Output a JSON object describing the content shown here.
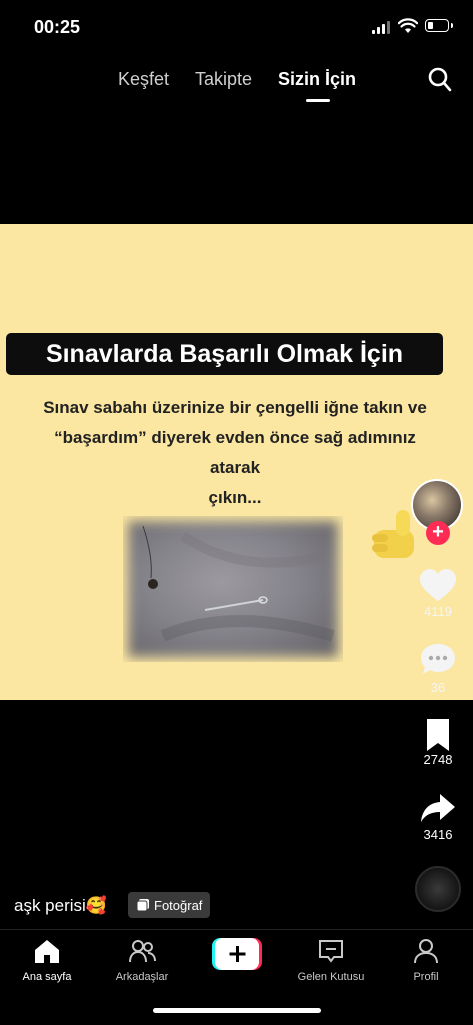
{
  "status_bar": {
    "time": "00:25",
    "battery_level": 0.3
  },
  "top_nav": {
    "tabs": [
      {
        "label": "Keşfet",
        "active": false
      },
      {
        "label": "Takipte",
        "active": false
      },
      {
        "label": "Sizin İçin",
        "active": true
      }
    ],
    "search_icon": "search-icon"
  },
  "post": {
    "title": "Sınavlarda Başarılı Olmak İçin",
    "text_lines": [
      "Sınav sabahı üzerinize bir çengelli iğne takın ve",
      "“başardım” diyerek evden önce sağ adımınız atarak",
      "çıkın..."
    ],
    "likes": "4119",
    "comments": "36",
    "bookmarks": "2748",
    "shares": "3416",
    "author": "aşk perisi🥰",
    "type_label": "Fotoğraf"
  },
  "colors": {
    "accent": "#fe2c55",
    "photo_bg": "#fbe7a2"
  },
  "bottom_nav": {
    "items": [
      {
        "label": "Ana sayfa",
        "icon": "home-icon",
        "active": true
      },
      {
        "label": "Arkadaşlar",
        "icon": "friends-icon",
        "active": false
      },
      {
        "label": "",
        "icon": "plus-icon",
        "active": false
      },
      {
        "label": "Gelen Kutusu",
        "icon": "inbox-icon",
        "active": false
      },
      {
        "label": "Profil",
        "icon": "profile-icon",
        "active": false
      }
    ]
  }
}
